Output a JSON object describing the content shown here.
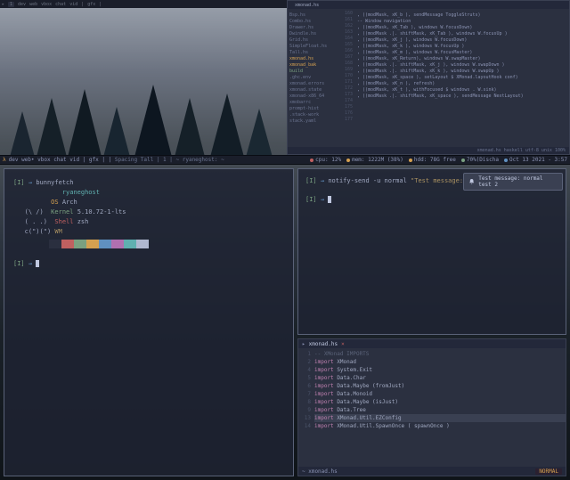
{
  "top": {
    "left_bar": [
      "dev",
      "web",
      "chat",
      "vid",
      "gfx",
      "dev",
      "1"
    ],
    "editor": {
      "filename": "xmonad.hs",
      "sidebar_files": [
        {
          "name": "Bsp.hs"
        },
        {
          "name": "Combo.hs"
        },
        {
          "name": "Drawer.hs"
        },
        {
          "name": "Dwindle.hs"
        },
        {
          "name": "Grid.hs"
        },
        {
          "name": "SimpleFloat.hs"
        },
        {
          "name": "Tall.hs"
        },
        {
          "name": "xmonad.hs",
          "hl": true
        },
        {
          "name": "xmonad_bak",
          "hl": true
        },
        {
          "name": "build",
          "g": true
        },
        {
          "name": ".ghc.env"
        },
        {
          "name": "xmonad.errors"
        },
        {
          "name": "xmonad.state"
        },
        {
          "name": "xmonad-x86_64"
        },
        {
          "name": "xmobarrc"
        },
        {
          "name": "prompt-hist"
        },
        {
          "name": ".stack-work"
        },
        {
          "name": "stack.yaml"
        }
      ],
      "lines": [
        "    , ((modMask,               xK_b     ), sendMessage ToggleStruts)",
        "",
        "    -- Window navigation",
        "    , ((modMask,               xK_Tab   ), windows W.focusDown)",
        "    , ((modMask .|. shiftMask, xK_Tab   ), windows W.focusUp  )",
        "    , ((modMask,               xK_j     ), windows W.focusDown)",
        "    , ((modMask,               xK_k     ), windows W.focusUp  )",
        "    , ((modMask,               xK_m     ), windows W.focusMaster)",
        "",
        "    , ((modMask,               xK_Return), windows W.swapMaster)",
        "    , ((modMask .|. shiftMask, xK_j     ), windows W.swapDown  )",
        "    , ((modMask .|. shiftMask, xK_k     ), windows W.swapUp    )",
        "",
        "    , ((modMask,               xK_space ), setLayout $ XMonad.layoutHook conf)",
        "    , ((modMask,               xK_n     ), refresh)",
        "",
        "    , ((modMask,               xK_t     ), withFocused $ windows . W.sink)",
        "    , ((modMask .|. shiftMask, xK_space ), sendMessage NextLayout)"
      ],
      "status": "xmonad.hs  haskell  utf-8  unix  100%"
    }
  },
  "midbar": {
    "logo": "λ",
    "workspaces": "dev web• vbox chat vid | gfx |",
    "layout": "Spacing Tall",
    "title": "| 1 | ~ ryaneghost: ~",
    "stats": {
      "cpu": "cpu: 12%",
      "mem": "mem: 1222M (38%)",
      "hdd": "hdd: 78G free",
      "bat": "70%(Discha",
      "date": "Oct 13 2021 - 3:57"
    }
  },
  "terminal_left": {
    "cmd": "bunnyfetch",
    "user": "ryaneghost",
    "os_label": "OS",
    "os": "Arch",
    "art1": "(\\ /)",
    "kernel_label": "Kernel",
    "kernel": "5.10.72-1-lts",
    "art2": "( . .)",
    "shell_label": "Shell",
    "shell": "zsh",
    "art3": "c(\")(\")",
    "wm_label": "WM",
    "wm": "",
    "palette": [
      "#2a2f3f",
      "#c06060",
      "#7aa080",
      "#d4a050",
      "#6090c0",
      "#b070b0",
      "#60b0b0",
      "#b0b8d0"
    ],
    "prompt2": "[I] → "
  },
  "terminal_right": {
    "cmd": "notify-send -u normal \"Test message: normal test 2\"",
    "prompt2": "[I] → "
  },
  "notification": {
    "text": "Test message: normal test 2"
  },
  "editor2": {
    "filename": "xmonad.hs",
    "lines": [
      {
        "n": "1",
        "c": "-- XMonad IMPORTS",
        "cls": "c"
      },
      {
        "n": "2",
        "c": "import XMonad",
        "cls": "kw"
      },
      {
        "n": "",
        "c": ""
      },
      {
        "n": "4",
        "c": "import System.Exit",
        "cls": "kw"
      },
      {
        "n": "5",
        "c": "import Data.Char",
        "cls": "kw"
      },
      {
        "n": "6",
        "c": "import Data.Maybe (fromJust)",
        "cls": "kw"
      },
      {
        "n": "7",
        "c": "import Data.Monoid",
        "cls": "kw"
      },
      {
        "n": "8",
        "c": "import Data.Maybe (isJust)",
        "cls": "kw"
      },
      {
        "n": "9",
        "c": "import Data.Tree",
        "cls": "kw"
      },
      {
        "n": "",
        "c": ""
      },
      {
        "n": "13",
        "c": "import XMonad.Util.EZConfig",
        "cls": "kw",
        "hl": true
      },
      {
        "n": "14",
        "c": "import XMonad.Util.SpawnOnce ( spawnOnce )",
        "cls": "kw"
      }
    ],
    "status_file": "~ xmonad.hs",
    "mode": "NORMAL"
  }
}
